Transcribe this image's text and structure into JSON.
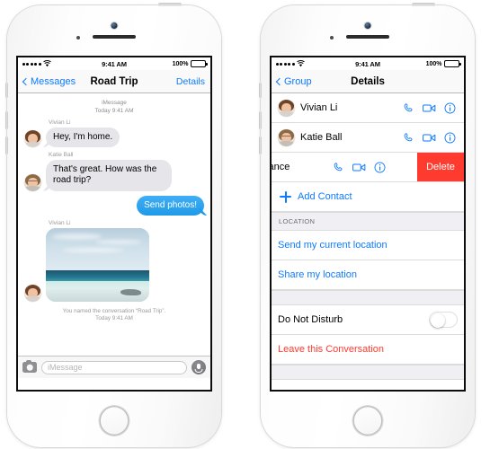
{
  "status_bar": {
    "signal_dots": 5,
    "wifi_icon": "wifi-icon",
    "time": "9:41 AM",
    "battery_percent": "100%",
    "battery_icon": "battery-full-icon"
  },
  "left_phone": {
    "nav": {
      "back_label": "Messages",
      "back_icon": "chevron-left-icon",
      "title": "Road Trip",
      "right_label": "Details"
    },
    "conversation": {
      "service_stamp_line1": "iMessage",
      "service_stamp_line2": "Today 9:41 AM",
      "messages": [
        {
          "sender": "Vivian Li",
          "direction": "in",
          "type": "text",
          "text": "Hey, I'm home."
        },
        {
          "sender": "Katie Ball",
          "direction": "in",
          "type": "text",
          "text": "That's great. How was the road trip?"
        },
        {
          "sender": "",
          "direction": "out",
          "type": "text",
          "text": "Send photos!"
        },
        {
          "sender": "Vivian Li",
          "direction": "in",
          "type": "photo",
          "text": "beach-ocean-photo"
        }
      ],
      "system_message_line1": "You named the conversation “Road Trip”.",
      "system_message_line2": "Today 9:41 AM"
    },
    "input_bar": {
      "camera_icon": "camera-icon",
      "placeholder": "iMessage",
      "mic_icon": "microphone-icon"
    }
  },
  "right_phone": {
    "nav": {
      "back_label": "Group",
      "back_icon": "chevron-left-icon",
      "title": "Details"
    },
    "contacts": [
      {
        "name": "Vivian Li",
        "swiped": false
      },
      {
        "name": "Katie Ball",
        "swiped": false
      },
      {
        "name": "Vance",
        "swiped": true,
        "delete_label": "Delete"
      }
    ],
    "action_icons": {
      "phone": "phone-icon",
      "video": "video-camera-icon",
      "info": "info-circle-icon"
    },
    "add_contact": {
      "label": "Add Contact",
      "icon": "plus-icon"
    },
    "location_section": {
      "header": "LOCATION",
      "items": [
        "Send my current location",
        "Share my location"
      ]
    },
    "do_not_disturb": {
      "label": "Do Not Disturb",
      "enabled": false
    },
    "leave_conversation": {
      "label": "Leave this Conversation"
    }
  },
  "colors": {
    "ios_blue": "#0e7aff",
    "bubble_out": "#1f9ae8",
    "bubble_in": "#e5e5ea",
    "destructive_red": "#ff3b30",
    "group_header_bg": "#efeff4",
    "secondary_text": "#8e8e93"
  }
}
